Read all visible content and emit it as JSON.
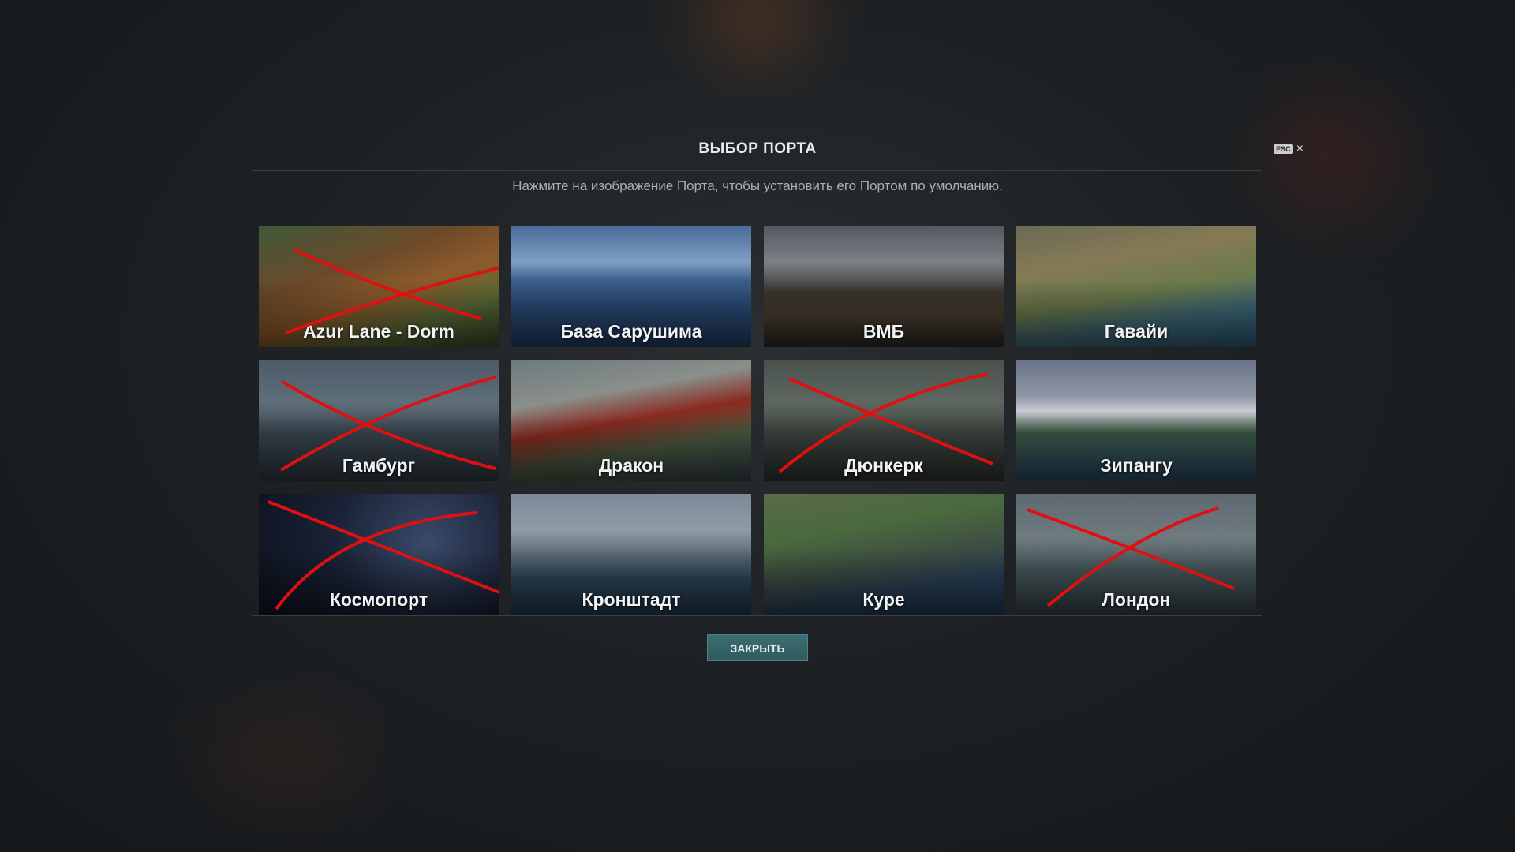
{
  "modal": {
    "title": "ВЫБОР ПОРТА",
    "esc_label": "ESC",
    "close_icon": "×",
    "subtitle": "Нажмите на изображение Порта, чтобы установить его Портом по умолчанию.",
    "close_button": "ЗАКРЫТЬ"
  },
  "ports": [
    {
      "name": "Azur Lane - Dorm",
      "crossed": true
    },
    {
      "name": "База Сарушима",
      "crossed": false
    },
    {
      "name": "ВМБ",
      "crossed": false
    },
    {
      "name": "Гавайи",
      "crossed": false
    },
    {
      "name": "Гамбург",
      "crossed": true
    },
    {
      "name": "Дракон",
      "crossed": false
    },
    {
      "name": "Дюнкерк",
      "crossed": true
    },
    {
      "name": "Зипангу",
      "crossed": false
    },
    {
      "name": "Космопорт",
      "crossed": true
    },
    {
      "name": "Кронштадт",
      "crossed": false
    },
    {
      "name": "Куре",
      "crossed": false
    },
    {
      "name": "Лондон",
      "crossed": true
    }
  ],
  "colors": {
    "accent_button": "#2f5a5e",
    "cross_mark": "#e01010"
  }
}
